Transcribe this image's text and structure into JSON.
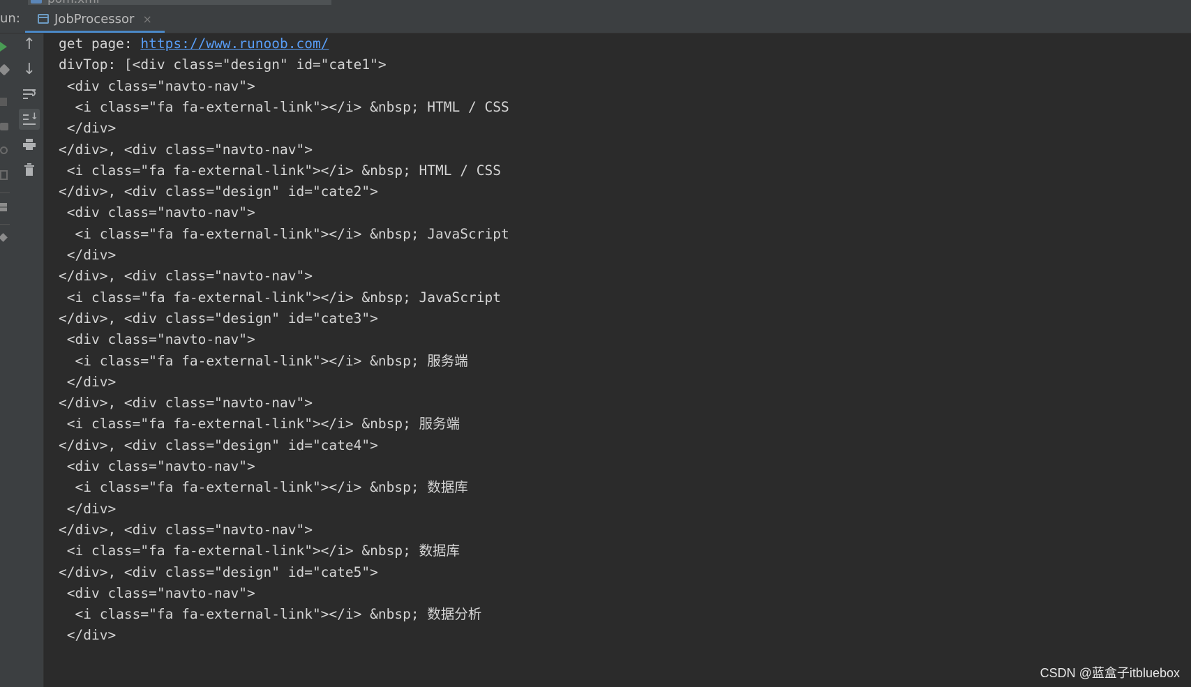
{
  "top_tab": {
    "label": "pom.xml"
  },
  "run_header": {
    "label": "un:",
    "tab_label": "JobProcessor",
    "tab_close": "×"
  },
  "console_toolbar": {
    "up_glyph": "↑",
    "down_glyph": "↓"
  },
  "console": {
    "first_prefix": "get page: ",
    "first_link": "https://www.runoob.com/",
    "lines": [
      "divTop: [<div class=\"design\" id=\"cate1\">",
      " <div class=\"navto-nav\">",
      "  <i class=\"fa fa-external-link\"></i> &nbsp; HTML / CSS",
      " </div>",
      "</div>, <div class=\"navto-nav\">",
      " <i class=\"fa fa-external-link\"></i> &nbsp; HTML / CSS",
      "</div>, <div class=\"design\" id=\"cate2\">",
      " <div class=\"navto-nav\">",
      "  <i class=\"fa fa-external-link\"></i> &nbsp; JavaScript",
      " </div>",
      "</div>, <div class=\"navto-nav\">",
      " <i class=\"fa fa-external-link\"></i> &nbsp; JavaScript",
      "</div>, <div class=\"design\" id=\"cate3\">",
      " <div class=\"navto-nav\">",
      "  <i class=\"fa fa-external-link\"></i> &nbsp; 服务端",
      " </div>",
      "</div>, <div class=\"navto-nav\">",
      " <i class=\"fa fa-external-link\"></i> &nbsp; 服务端",
      "</div>, <div class=\"design\" id=\"cate4\">",
      " <div class=\"navto-nav\">",
      "  <i class=\"fa fa-external-link\"></i> &nbsp; 数据库",
      " </div>",
      "</div>, <div class=\"navto-nav\">",
      " <i class=\"fa fa-external-link\"></i> &nbsp; 数据库",
      "</div>, <div class=\"design\" id=\"cate5\">",
      " <div class=\"navto-nav\">",
      "  <i class=\"fa fa-external-link\"></i> &nbsp; 数据分析",
      " </div>"
    ]
  },
  "watermark": "CSDN @蓝盒子itbluebox",
  "colors": {
    "background": "#2b2b2b",
    "toolbar": "#3c3f41",
    "text": "#d4d4d4",
    "link": "#589df6",
    "run_green": "#499c54",
    "tab_underline": "#4a88c7"
  }
}
